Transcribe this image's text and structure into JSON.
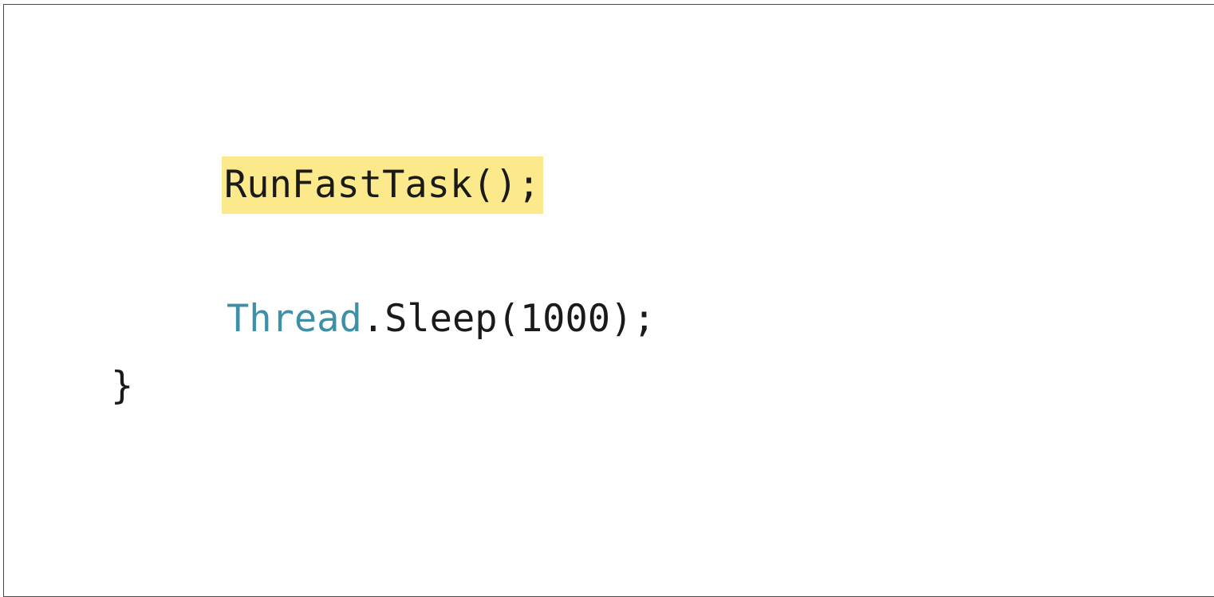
{
  "code": {
    "line1": {
      "text": "RunFastTask();",
      "highlight_color": "#fbe98b"
    },
    "line2": {
      "type_name": "Thread",
      "rest": ".Sleep(1000);",
      "type_color": "#3e8fa8"
    },
    "line3": {
      "text": "}"
    }
  }
}
